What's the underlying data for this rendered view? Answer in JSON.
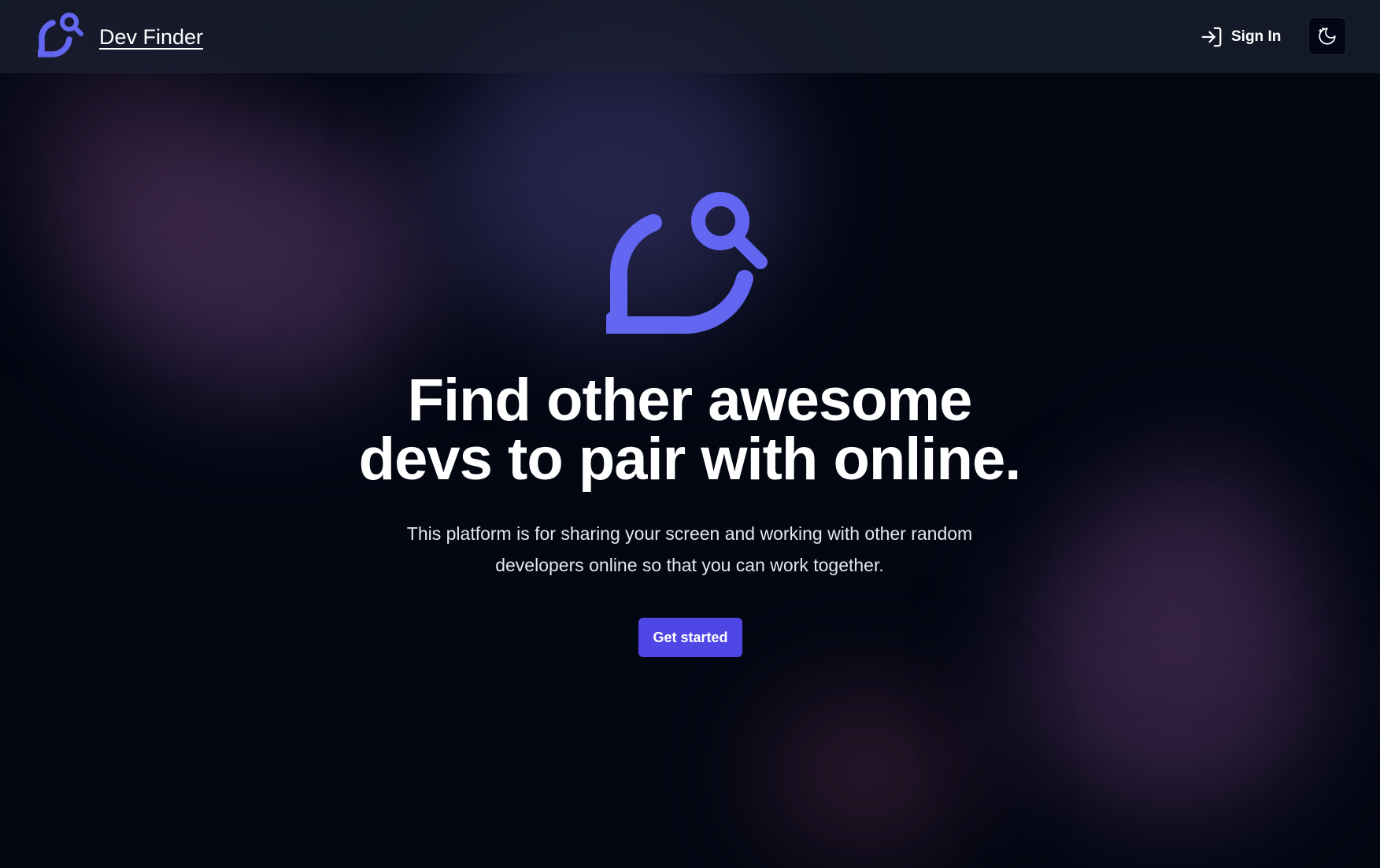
{
  "header": {
    "brand_name": "Dev Finder",
    "brand_icon": "chat-search-icon",
    "sign_in_label": "Sign In",
    "sign_in_icon": "log-in-icon",
    "theme_toggle_icon": "moon-sun-icon"
  },
  "hero": {
    "icon": "chat-search-icon",
    "title_line1": "Find other awesome",
    "title_line2": "devs to pair with online.",
    "subtitle_line1": "This platform is for sharing your screen and working with other random",
    "subtitle_line2": "developers online so that you can work together.",
    "cta_label": "Get started"
  },
  "colors": {
    "accent": "#6366f1",
    "button": "#4f46e5",
    "background": "#030712",
    "navbar": "#1e2234"
  }
}
